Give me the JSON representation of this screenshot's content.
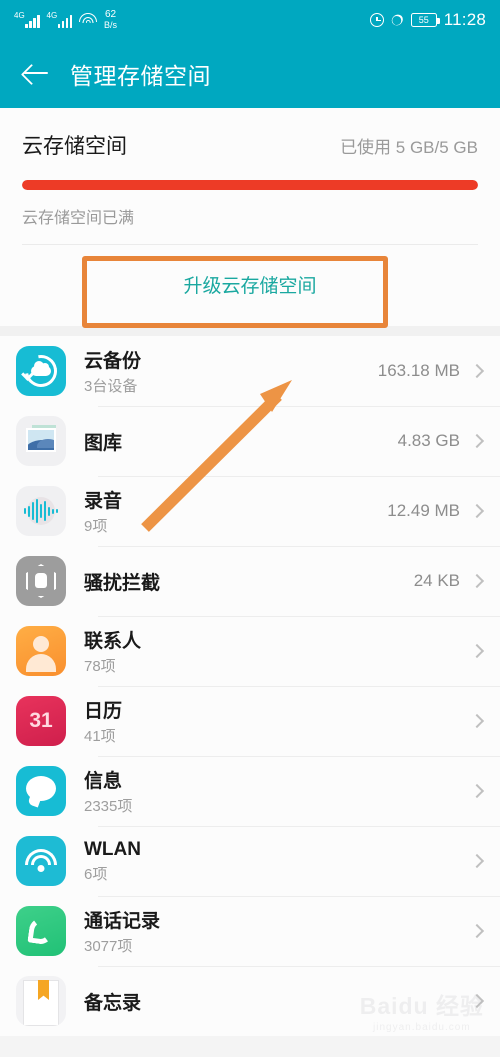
{
  "status_bar": {
    "sim1_network": "4G",
    "sim2_network": "4G",
    "net_speed_value": "62",
    "net_speed_unit": "B/s",
    "battery_percent": "55",
    "time": "11:28",
    "icons": [
      "signal-icon",
      "signal-icon",
      "wifi-icon",
      "alarm-icon",
      "bluetooth-icon",
      "battery-icon"
    ]
  },
  "app_bar": {
    "back_icon": "back-arrow-icon",
    "title": "管理存储空间"
  },
  "quota": {
    "name": "云存储空间",
    "used_label": "已使用 5 GB/5 GB",
    "progress_percent": 100,
    "progress_color": "#ed3b26",
    "full_note": "云存储空间已满",
    "upgrade_label": "升级云存储空间",
    "upgrade_color": "#1aa8a0"
  },
  "list": [
    {
      "icon": "cloud-backup-icon",
      "name": "云备份",
      "sub": "3台设备",
      "value": "163.18 MB"
    },
    {
      "icon": "gallery-icon",
      "name": "图库",
      "sub": "",
      "value": "4.83 GB"
    },
    {
      "icon": "recorder-icon",
      "name": "录音",
      "sub": "9项",
      "value": "12.49 MB"
    },
    {
      "icon": "block-icon",
      "name": "骚扰拦截",
      "sub": "",
      "value": "24 KB"
    },
    {
      "icon": "contacts-icon",
      "name": "联系人",
      "sub": "78项",
      "value": ""
    },
    {
      "icon": "calendar-icon",
      "name": "日历",
      "sub": "41项",
      "value": "",
      "icon_text": "31"
    },
    {
      "icon": "messages-icon",
      "name": "信息",
      "sub": "2335项",
      "value": ""
    },
    {
      "icon": "wlan-icon",
      "name": "WLAN",
      "sub": "6项",
      "value": ""
    },
    {
      "icon": "call-log-icon",
      "name": "通话记录",
      "sub": "3077项",
      "value": ""
    },
    {
      "icon": "notes-icon",
      "name": "备忘录",
      "sub": "",
      "value": ""
    }
  ],
  "annotations": {
    "box_color": "#e8853a",
    "arrow_color": "#ed9445"
  },
  "watermark": {
    "line1": "Baidu 经验",
    "line2": "jingyan.baidu.com"
  }
}
